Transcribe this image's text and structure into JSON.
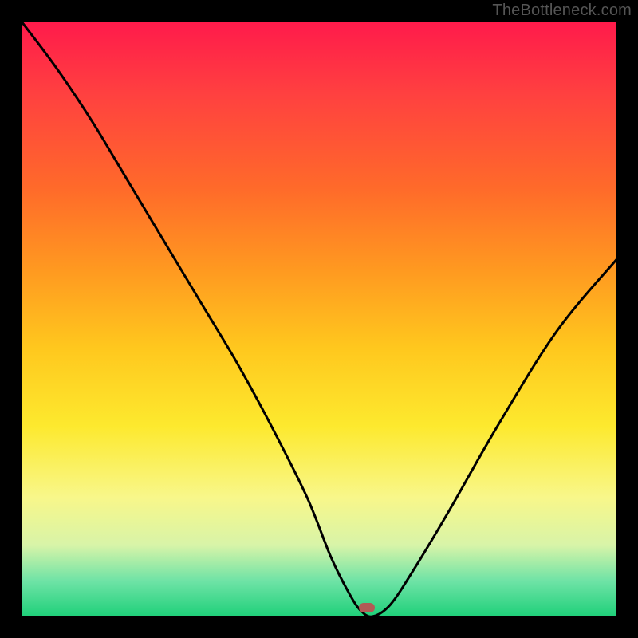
{
  "attribution": "TheBottleneck.com",
  "chart_data": {
    "type": "line",
    "title": "",
    "xlabel": "",
    "ylabel": "",
    "xlim": [
      0,
      100
    ],
    "ylim": [
      0,
      100
    ],
    "series": [
      {
        "name": "bottleneck-curve",
        "x": [
          0,
          6,
          12,
          18,
          24,
          30,
          36,
          42,
          48,
          52,
          55,
          57,
          59,
          62,
          66,
          72,
          80,
          90,
          100
        ],
        "y": [
          100,
          92,
          83,
          73,
          63,
          53,
          43,
          32,
          20,
          10,
          4,
          1,
          0,
          2,
          8,
          18,
          32,
          48,
          60
        ]
      }
    ],
    "marker": {
      "x": 58,
      "y": 1.5
    },
    "gradient_stops": [
      {
        "pct": 0,
        "color": "#ff1a4b"
      },
      {
        "pct": 12,
        "color": "#ff4040"
      },
      {
        "pct": 28,
        "color": "#ff6a2a"
      },
      {
        "pct": 42,
        "color": "#ff9a20"
      },
      {
        "pct": 55,
        "color": "#ffc81e"
      },
      {
        "pct": 68,
        "color": "#fde92e"
      },
      {
        "pct": 80,
        "color": "#f8f78a"
      },
      {
        "pct": 88,
        "color": "#d8f4a8"
      },
      {
        "pct": 94,
        "color": "#6fe3a6"
      },
      {
        "pct": 100,
        "color": "#1fd07a"
      }
    ]
  }
}
